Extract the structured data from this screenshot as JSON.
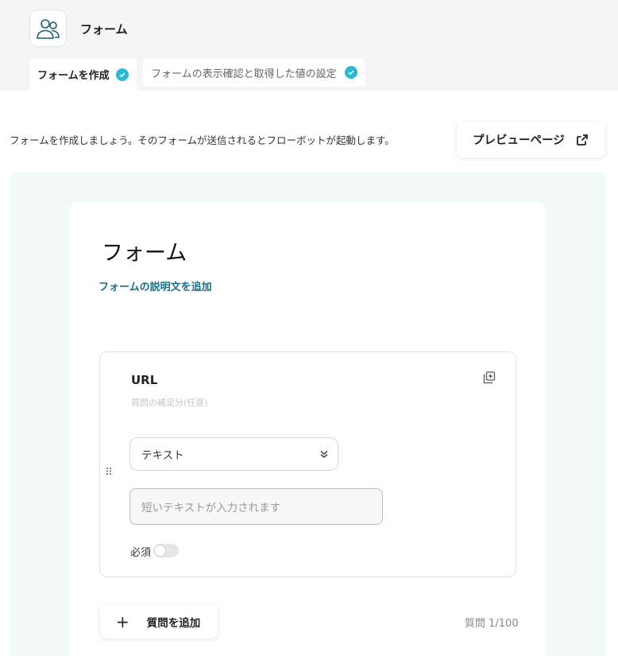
{
  "app": {
    "icon": "users-icon",
    "title": "フォーム"
  },
  "tabs": [
    {
      "label": "フォームを作成",
      "status_icon": "check-circle-icon"
    },
    {
      "label": "フォームの表示確認と取得した値の設定",
      "status_icon": "check-circle-icon"
    }
  ],
  "intro": {
    "text": "フォームを作成しましょう。そのフォームが送信されるとフローボットが起動します。"
  },
  "preview": {
    "label": "プレビューページ",
    "icon": "external-link-icon"
  },
  "form": {
    "title": "フォーム",
    "add_description_label": "フォームの説明文を追加",
    "question": {
      "label": "URL",
      "help_placeholder": "質問の補足分(任意)",
      "type_value": "テキスト",
      "answer_placeholder": "短いテキストが入力されます",
      "required_label": "必須",
      "required_on": false
    },
    "add_question_label": "質問を追加",
    "question_count": "質問 1/100"
  },
  "colors": {
    "accent": "#2ab8d6",
    "link": "#1b6f86",
    "canvas": "#f2faf8",
    "topbar": "#f5f5f5"
  }
}
